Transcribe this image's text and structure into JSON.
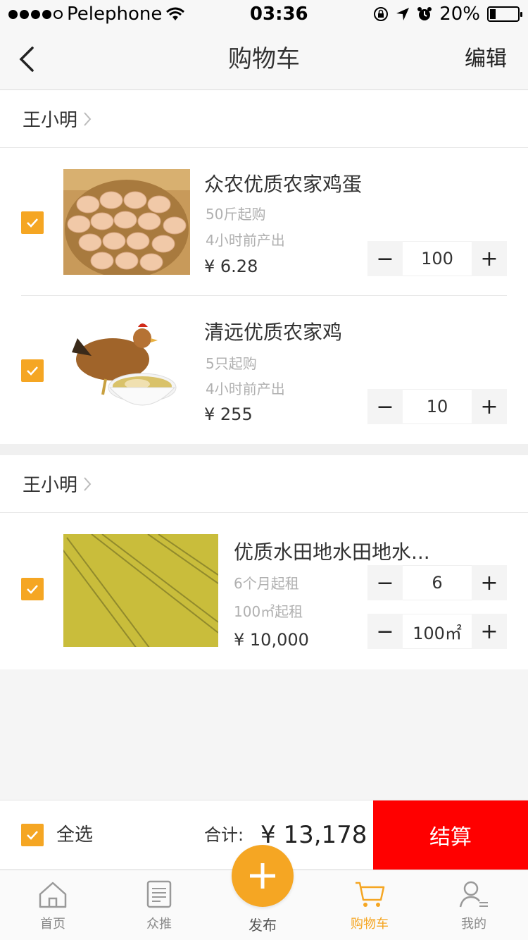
{
  "status_bar": {
    "carrier": "Pelephone",
    "time": "03:36",
    "battery": "20%",
    "battery_level": 0.2
  },
  "nav": {
    "title": "购物车",
    "edit_label": "编辑"
  },
  "shops": [
    {
      "name": "王小明",
      "items": [
        {
          "title": "众农优质农家鸡蛋",
          "sub1": "50斤起购",
          "sub2": "4小时前产出",
          "price": "¥ 6.28",
          "quantity": "100"
        },
        {
          "title": "清远优质农家鸡",
          "sub1": "5只起购",
          "sub2": "4小时前产出",
          "price": "¥ 255",
          "quantity": "10"
        }
      ]
    },
    {
      "name": "王小明",
      "items": [
        {
          "title": "优质水田地水田地水...",
          "sub1": "6个月起租",
          "sub2": "100㎡起租",
          "price": "¥ 10,000",
          "quantity": "6",
          "area": "100㎡"
        }
      ]
    }
  ],
  "summary": {
    "select_all": "全选",
    "total_label": "合计:",
    "total_value": "¥ 13,178",
    "checkout": "结算"
  },
  "tabs": [
    {
      "label": "首页",
      "icon": "home-icon"
    },
    {
      "label": "众推",
      "icon": "document-icon"
    },
    {
      "label": "发布",
      "icon": "plus-icon"
    },
    {
      "label": "购物车",
      "icon": "cart-icon",
      "active": true
    },
    {
      "label": "我的",
      "icon": "user-icon"
    }
  ],
  "colors": {
    "accent": "#f5a623",
    "checkout": "#ff0000"
  }
}
